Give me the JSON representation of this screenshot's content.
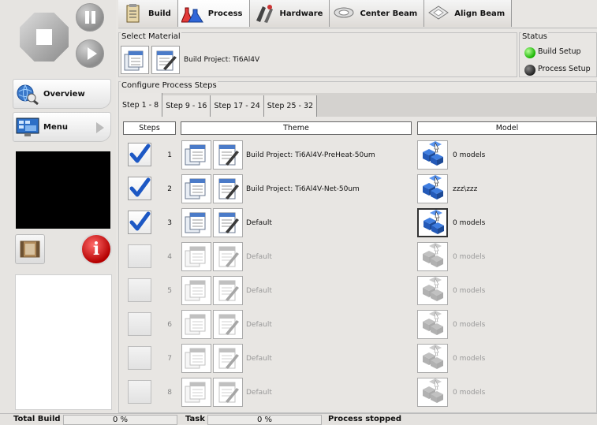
{
  "toolbar": {
    "tabs": [
      {
        "label": "Build",
        "icon": "build-clipboard-icon",
        "active": false
      },
      {
        "label": "Process",
        "icon": "process-flasks-icon",
        "active": true
      },
      {
        "label": "Hardware",
        "icon": "hardware-icon",
        "active": false
      },
      {
        "label": "Center Beam",
        "icon": "center-beam-icon",
        "active": false
      },
      {
        "label": "Align Beam",
        "icon": "align-beam-icon",
        "active": false
      }
    ]
  },
  "nav": {
    "overview_label": "Overview",
    "menu_label": "Menu"
  },
  "select_material": {
    "title": "Select Material",
    "project": "Build Project: Ti6Al4V"
  },
  "status": {
    "title": "Status",
    "items": [
      {
        "label": "Build Setup",
        "color": "#16b300"
      },
      {
        "label": "Process Setup",
        "color": "#222222"
      }
    ]
  },
  "configure": {
    "title": "Configure Process Steps",
    "tabs": [
      "Step 1 - 8",
      "Step 9 - 16",
      "Step 17 - 24",
      "Step 25 - 32"
    ],
    "active_tab": 0,
    "columns": {
      "steps": "Steps",
      "theme": "Theme",
      "model": "Model"
    },
    "rows": [
      {
        "num": "1",
        "checked": true,
        "enabled": true,
        "theme": "Build Project: Ti6Al4V-PreHeat-50um",
        "model": "0 models"
      },
      {
        "num": "2",
        "checked": true,
        "enabled": true,
        "theme": "Build Project: Ti6Al4V-Net-50um",
        "model": "zzz\\zzz"
      },
      {
        "num": "3",
        "checked": true,
        "enabled": true,
        "theme": "Default",
        "model": "0 models"
      },
      {
        "num": "4",
        "checked": false,
        "enabled": false,
        "theme": "Default",
        "model": "0 models"
      },
      {
        "num": "5",
        "checked": false,
        "enabled": false,
        "theme": "Default",
        "model": "0 models"
      },
      {
        "num": "6",
        "checked": false,
        "enabled": false,
        "theme": "Default",
        "model": "0 models"
      },
      {
        "num": "7",
        "checked": false,
        "enabled": false,
        "theme": "Default",
        "model": "0 models"
      },
      {
        "num": "8",
        "checked": false,
        "enabled": false,
        "theme": "Default",
        "model": "0 models"
      }
    ]
  },
  "statusbar": {
    "total_build_label": "Total Build",
    "total_build_value": "0 %",
    "task_label": "Task",
    "task_value": "0 %",
    "message": "Process stopped"
  }
}
